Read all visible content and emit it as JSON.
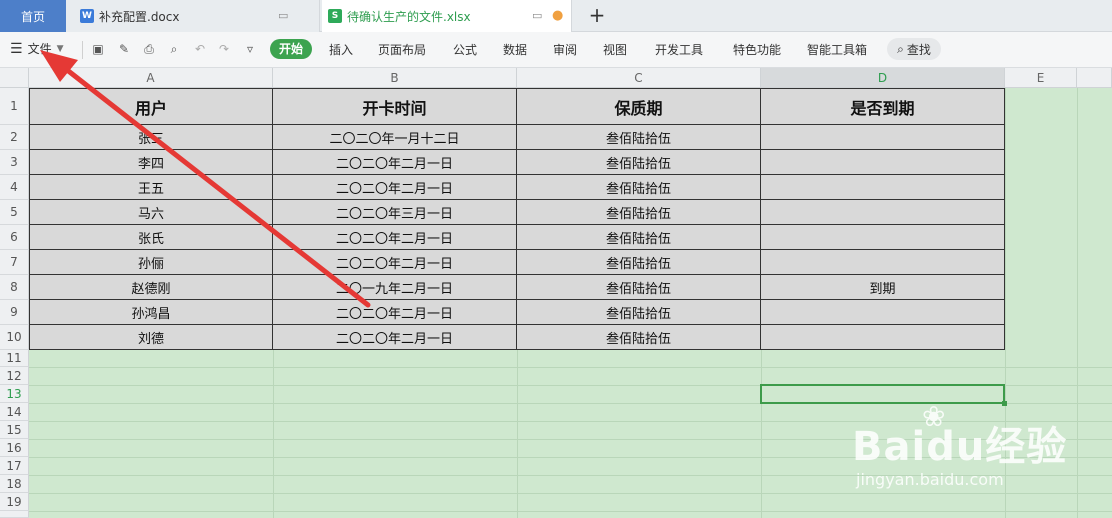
{
  "tabs": {
    "home": "首页",
    "doc": "补充配置.docx",
    "xls": "待确认生产的文件.xlsx"
  },
  "toolbar": {
    "file_label": "文件",
    "start": "开始",
    "menus": [
      "插入",
      "页面布局",
      "公式",
      "数据",
      "审阅",
      "视图",
      "开发工具",
      "特色功能",
      "智能工具箱"
    ],
    "search": "查找"
  },
  "columns": [
    "A",
    "B",
    "C",
    "D",
    "E"
  ],
  "rows": [
    "1",
    "2",
    "3",
    "4",
    "5",
    "6",
    "7",
    "8",
    "9",
    "10",
    "11",
    "12",
    "13",
    "14",
    "15",
    "16",
    "17",
    "18",
    "19"
  ],
  "table": {
    "headers": [
      "用户",
      "开卡时间",
      "保质期",
      "是否到期"
    ],
    "data": [
      [
        "张三",
        "二〇二〇年一月十二日",
        "叁佰陆拾伍",
        ""
      ],
      [
        "李四",
        "二〇二〇年二月一日",
        "叁佰陆拾伍",
        ""
      ],
      [
        "王五",
        "二〇二〇年二月一日",
        "叁佰陆拾伍",
        ""
      ],
      [
        "马六",
        "二〇二〇年三月一日",
        "叁佰陆拾伍",
        ""
      ],
      [
        "张氏",
        "二〇二〇年二月一日",
        "叁佰陆拾伍",
        ""
      ],
      [
        "孙俪",
        "二〇二〇年二月一日",
        "叁佰陆拾伍",
        ""
      ],
      [
        "赵德刚",
        "二〇一九年二月一日",
        "叁佰陆拾伍",
        "到期"
      ],
      [
        "孙鸿昌",
        "二〇二〇年二月一日",
        "叁佰陆拾伍",
        ""
      ],
      [
        "刘德",
        "二〇二〇年二月一日",
        "叁佰陆拾伍",
        ""
      ]
    ]
  },
  "watermark": {
    "brand": "Baidu经验",
    "url": "jingyan.baidu.com"
  },
  "colors": {
    "accent": "#3ca34f",
    "sheet_bg": "#cfe8cf",
    "arrow": "#e53935"
  }
}
